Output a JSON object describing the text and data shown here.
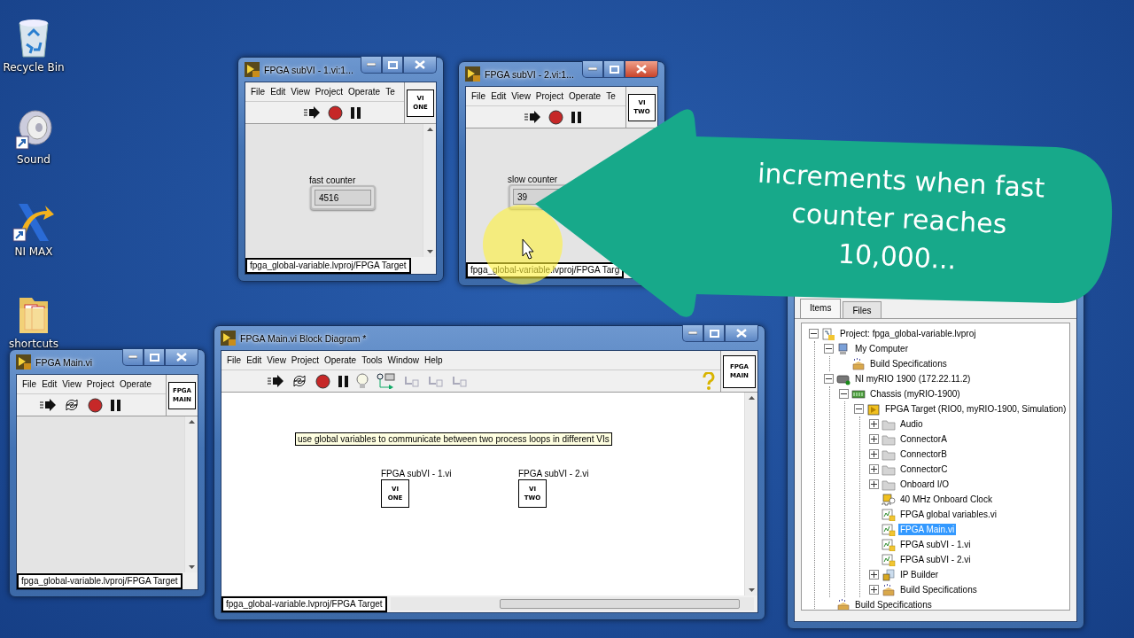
{
  "desktop_icons": [
    {
      "label": "Recycle Bin",
      "kind": "recycle"
    },
    {
      "label": "Sound",
      "kind": "sound"
    },
    {
      "label": "NI MAX",
      "kind": "nimax"
    },
    {
      "label": "shortcuts",
      "kind": "folder"
    }
  ],
  "windows": [
    {
      "kind": "front_panel",
      "title": "FPGA subVI - 1.vi:1...",
      "close_hovered": false,
      "menu": [
        "File",
        "Edit",
        "View",
        "Project",
        "Operate",
        "Te"
      ],
      "toolbar": [
        {
          "kind": "run"
        },
        {
          "kind": "abort"
        },
        {
          "kind": "pause"
        }
      ],
      "vi_icon": [
        "VI",
        "ONE"
      ],
      "control": {
        "label": "fast counter",
        "value": "4516"
      },
      "path": "fpga_global-variable.lvproj/FPGA Target"
    },
    {
      "kind": "front_panel",
      "title": "FPGA subVI - 2.vi:1...",
      "close_hovered": true,
      "menu": [
        "File",
        "Edit",
        "View",
        "Project",
        "Operate",
        "Te"
      ],
      "toolbar": [
        {
          "kind": "run"
        },
        {
          "kind": "abort"
        },
        {
          "kind": "pause"
        }
      ],
      "vi_icon": [
        "VI",
        "TWO"
      ],
      "control": {
        "label": "slow counter",
        "value": "39"
      },
      "path": "fpga_global-variable.lvproj/FPGA Targ"
    },
    {
      "kind": "front_panel",
      "title": "FPGA Main.vi",
      "close_hovered": false,
      "menu": [
        "File",
        "Edit",
        "View",
        "Project",
        "Operate"
      ],
      "toolbar": [
        {
          "kind": "run"
        },
        {
          "kind": "cont"
        },
        {
          "kind": "abort"
        },
        {
          "kind": "pause"
        }
      ],
      "vi_icon": [
        "FPGA",
        "MAIN"
      ],
      "path": "fpga_global-variable.lvproj/FPGA Target"
    },
    {
      "kind": "block_diagram",
      "title": "FPGA Main.vi Block Diagram *",
      "close_hovered": false,
      "menu": [
        "File",
        "Edit",
        "View",
        "Project",
        "Operate",
        "Tools",
        "Window",
        "Help"
      ],
      "toolbar": [
        {
          "kind": "run"
        },
        {
          "kind": "cont"
        },
        {
          "kind": "abort"
        },
        {
          "kind": "pause"
        },
        {
          "kind": "bulb"
        },
        {
          "kind": "probe"
        },
        {
          "kind": "step"
        },
        {
          "kind": "step"
        },
        {
          "kind": "step"
        },
        {
          "kind": "spacer"
        },
        {
          "kind": "help"
        }
      ],
      "vi_icon": [
        "FPGA",
        "MAIN"
      ],
      "comment": "use global variables to communicate between two process loops in different VIs",
      "nodes": [
        {
          "label": "FPGA subVI - 1.vi",
          "vi_icon": [
            "VI",
            "ONE"
          ]
        },
        {
          "label": "FPGA subVI - 2.vi",
          "vi_icon": [
            "VI",
            "TWO"
          ]
        }
      ],
      "path": "fpga_global-variable.lvproj/FPGA Target"
    },
    {
      "kind": "project",
      "tabs": [
        {
          "label": "Items",
          "selected": true
        },
        {
          "label": "Files",
          "selected": false
        }
      ],
      "tree": [
        {
          "label": "Project: fpga_global-variable.lvproj",
          "kind": "project",
          "expanded": true,
          "selected": false,
          "children": [
            {
              "label": "My Computer",
              "kind": "computer",
              "expanded": true,
              "selected": false,
              "children": [
                {
                  "label": "Build Specifications",
                  "kind": "build",
                  "selected": false
                }
              ]
            },
            {
              "label": "NI myRIO 1900 (172.22.11.2)",
              "kind": "target",
              "expanded": true,
              "selected": false,
              "children": [
                {
                  "label": "Chassis (myRIO-1900)",
                  "kind": "chassis",
                  "expanded": true,
                  "selected": false,
                  "children": [
                    {
                      "label": "FPGA Target (RIO0, myRIO-1900, Simulation)",
                      "kind": "fpga",
                      "expanded": true,
                      "selected": false,
                      "children": [
                        {
                          "label": "Audio",
                          "kind": "folder",
                          "expanded": false,
                          "selected": false
                        },
                        {
                          "label": "ConnectorA",
                          "kind": "folder",
                          "expanded": false,
                          "selected": false
                        },
                        {
                          "label": "ConnectorB",
                          "kind": "folder",
                          "expanded": false,
                          "selected": false
                        },
                        {
                          "label": "ConnectorC",
                          "kind": "folder",
                          "expanded": false,
                          "selected": false
                        },
                        {
                          "label": "Onboard I/O",
                          "kind": "folder",
                          "expanded": false,
                          "selected": false
                        },
                        {
                          "label": "40 MHz Onboard Clock",
                          "kind": "clock",
                          "selected": false
                        },
                        {
                          "label": "FPGA global variables.vi",
                          "kind": "vi",
                          "selected": false
                        },
                        {
                          "label": "FPGA Main.vi",
                          "kind": "vi",
                          "selected": true
                        },
                        {
                          "label": "FPGA subVI - 1.vi",
                          "kind": "vi",
                          "selected": false
                        },
                        {
                          "label": "FPGA subVI - 2.vi",
                          "kind": "vi",
                          "selected": false
                        },
                        {
                          "label": "IP Builder",
                          "kind": "ipbuilder",
                          "expanded": false,
                          "selected": false
                        },
                        {
                          "label": "Build Specifications",
                          "kind": "build",
                          "expanded": false,
                          "selected": false
                        }
                      ]
                    }
                  ]
                }
              ]
            },
            {
              "label": "Build Specifications",
              "kind": "build",
              "selected": false
            }
          ]
        }
      ]
    }
  ],
  "callout": {
    "lines": [
      "increments when fast",
      "counter reaches",
      "10,000..."
    ]
  }
}
